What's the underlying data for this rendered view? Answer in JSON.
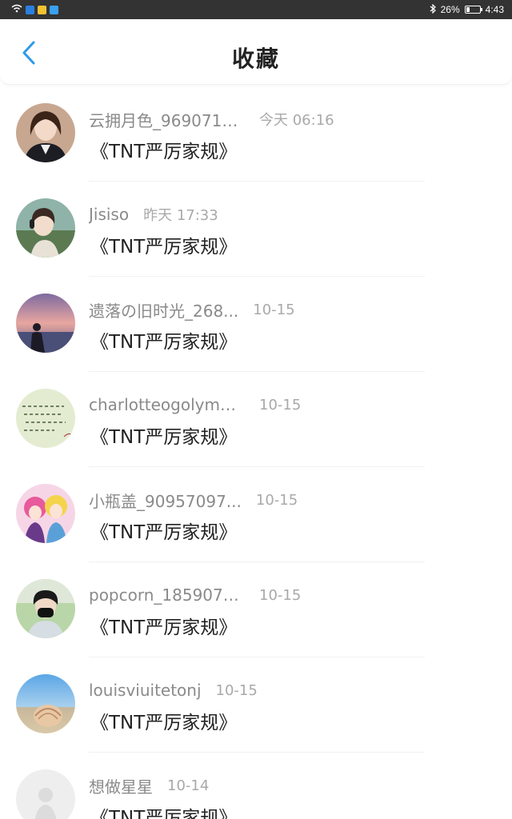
{
  "status_bar": {
    "battery": "26%",
    "time": "4:43",
    "battery_level": 0.26,
    "icons": [
      "wifi-icon",
      "app-icon-blue",
      "app-icon-yellow",
      "app-icon-cloud",
      "bluetooth-icon",
      "battery-icon"
    ]
  },
  "header": {
    "title": "收藏",
    "back_icon": "chevron-left-icon",
    "accent": "#2d9be8"
  },
  "items": [
    {
      "username": "云拥月色_9690713...",
      "time": "今天 06:16",
      "title": "《TNT严厉家规》",
      "avatar": "girl-portrait"
    },
    {
      "username": "Jisiso",
      "time": "昨天 17:33",
      "title": "《TNT严厉家规》",
      "avatar": "anime-headphones"
    },
    {
      "username": "遗落の旧时光_268...",
      "time": "10-15",
      "title": "《TNT严厉家规》",
      "avatar": "sunset-silhouette"
    },
    {
      "username": "charlotteogolympi...",
      "time": "10-15",
      "title": "《TNT严厉家规》",
      "avatar": "handwriting-note"
    },
    {
      "username": "小瓶盖_90957097...",
      "time": "10-15",
      "title": "《TNT严厉家规》",
      "avatar": "anime-girls"
    },
    {
      "username": "popcorn_1859071...",
      "time": "10-15",
      "title": "《TNT严厉家规》",
      "avatar": "masked-boy"
    },
    {
      "username": "louisviuitetonj",
      "time": "10-15",
      "title": "《TNT严厉家规》",
      "avatar": "seashell-beach"
    },
    {
      "username": "想做星星",
      "time": "10-14",
      "title": "《TNT严厉家规》",
      "avatar": "faded-figure"
    }
  ]
}
